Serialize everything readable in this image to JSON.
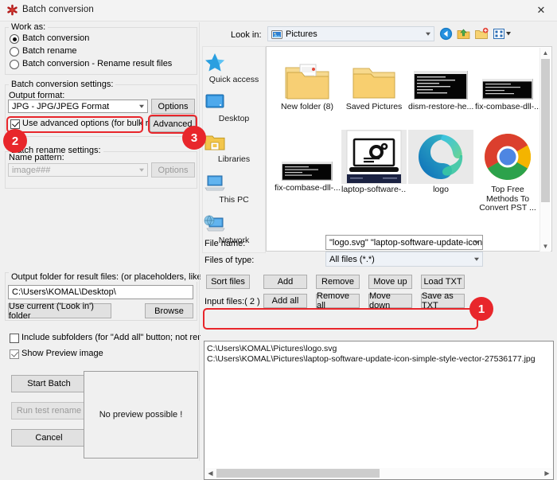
{
  "window": {
    "title": "Batch conversion",
    "app_icon": "red-asterisk-icon",
    "close_label": "✕"
  },
  "left_panel": {
    "work_as": {
      "legend": "Work as:",
      "options": [
        {
          "label": "Batch conversion",
          "selected": true
        },
        {
          "label": "Batch rename",
          "selected": false
        },
        {
          "label": "Batch conversion - Rename result files",
          "selected": false
        }
      ]
    },
    "conversion_settings": {
      "legend": "Batch conversion settings:",
      "output_format_label": "Output format:",
      "output_format_value": "JPG - JPG/JPEG Format",
      "options_button": "Options",
      "advanced_checkbox_label": "Use advanced options (for bulk resize...)",
      "advanced_checkbox_checked": true,
      "advanced_button": "Advanced"
    },
    "rename_settings": {
      "legend": "Batch rename settings:",
      "name_pattern_label": "Name pattern:",
      "name_pattern_value": "image###",
      "name_pattern_disabled": true,
      "options_button": "Options",
      "options_disabled": true
    },
    "output_folder": {
      "label": "Output folder for result files: (or placeholders, like: $D)",
      "path_value": "C:\\Users\\KOMAL\\Desktop\\",
      "use_current_button": "Use current ('Look in') folder",
      "browse_button": "Browse"
    },
    "checkboxes": [
      {
        "label": "Include subfolders (for \"Add all\" button; not remembered)",
        "checked": false
      },
      {
        "label": "Show Preview image",
        "checked": true
      }
    ],
    "action_buttons": [
      {
        "label": "Start Batch",
        "disabled": false
      },
      {
        "label": "Run test rename",
        "disabled": true
      },
      {
        "label": "Cancel",
        "disabled": false
      }
    ],
    "preview": {
      "text": "No preview possible !"
    }
  },
  "file_dialog": {
    "look_in_label": "Look in:",
    "look_in_value": "Pictures",
    "look_in_icon": "pictures-folder-icon",
    "toolbar": [
      {
        "name": "back-icon",
        "title": "Back"
      },
      {
        "name": "up-folder-icon",
        "title": "Up one level"
      },
      {
        "name": "new-folder-icon",
        "title": "Create New Folder"
      },
      {
        "name": "views-icon",
        "title": "Views"
      }
    ],
    "places": [
      {
        "label": "Quick access",
        "icon": "star-icon"
      },
      {
        "label": "Desktop",
        "icon": "desktop-icon"
      },
      {
        "label": "Libraries",
        "icon": "libraries-folder-icon"
      },
      {
        "label": "This PC",
        "icon": "this-pc-icon"
      },
      {
        "label": "Network",
        "icon": "network-icon"
      }
    ],
    "items": [
      {
        "label": "New folder (8)",
        "icon": "folder-with-images-icon",
        "selected": false
      },
      {
        "label": "Saved Pictures",
        "icon": "folder-icon",
        "selected": false
      },
      {
        "label": "dism-restore-he...",
        "icon": "terminal-screenshot-icon",
        "selected": false
      },
      {
        "label": "fix-combase-dll-...",
        "icon": "terminal-screenshot-icon",
        "selected": false
      },
      {
        "label": "fix-combase-dll-...",
        "icon": "terminal-screenshot-icon",
        "selected": false
      },
      {
        "label": "laptop-software-...",
        "icon": "laptop-gear-icon",
        "selected": true
      },
      {
        "label": "logo",
        "icon": "edge-logo-icon",
        "selected": true
      },
      {
        "label": "Top Free Methods To Convert PST ...",
        "icon": "chrome-logo-icon",
        "selected": false
      }
    ],
    "file_name_label": "File name:",
    "file_name_value": "\"logo.svg\" \"laptop-software-update-icon-simple-",
    "files_of_type_label": "Files of type:",
    "files_of_type_value": "All files (*.*)",
    "buttons_row1": [
      "Sort files",
      "Add",
      "Remove",
      "Move up",
      "Load TXT"
    ],
    "buttons_row2": [
      "Add all",
      "Remove all",
      "Move down",
      "Save as TXT"
    ],
    "input_files_label": "Input files:( 2 )",
    "input_files": [
      "C:\\Users\\KOMAL\\Pictures\\logo.svg",
      "C:\\Users\\KOMAL\\Pictures\\laptop-software-update-icon-simple-style-vector-27536177.jpg"
    ]
  },
  "annotations": {
    "accent_color": "#e8262b",
    "badges": [
      {
        "number": "1"
      },
      {
        "number": "2"
      },
      {
        "number": "3"
      }
    ]
  }
}
